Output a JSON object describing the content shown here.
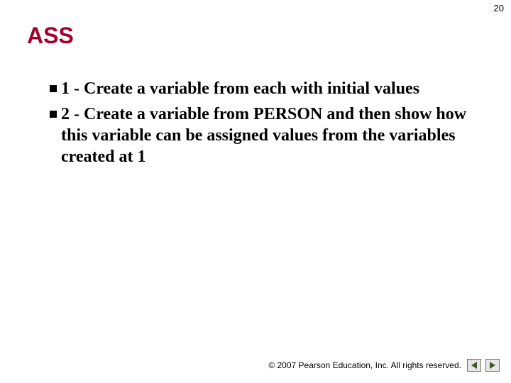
{
  "page_number": "20",
  "title": "ASS",
  "bullets": [
    "1 - Create a variable from each with initial values",
    "2 - Create a variable from PERSON and then show how this variable can be assigned values from the variables created at 1"
  ],
  "footer": {
    "copyright": "© 2007 Pearson Education, Inc.  All rights reserved."
  }
}
